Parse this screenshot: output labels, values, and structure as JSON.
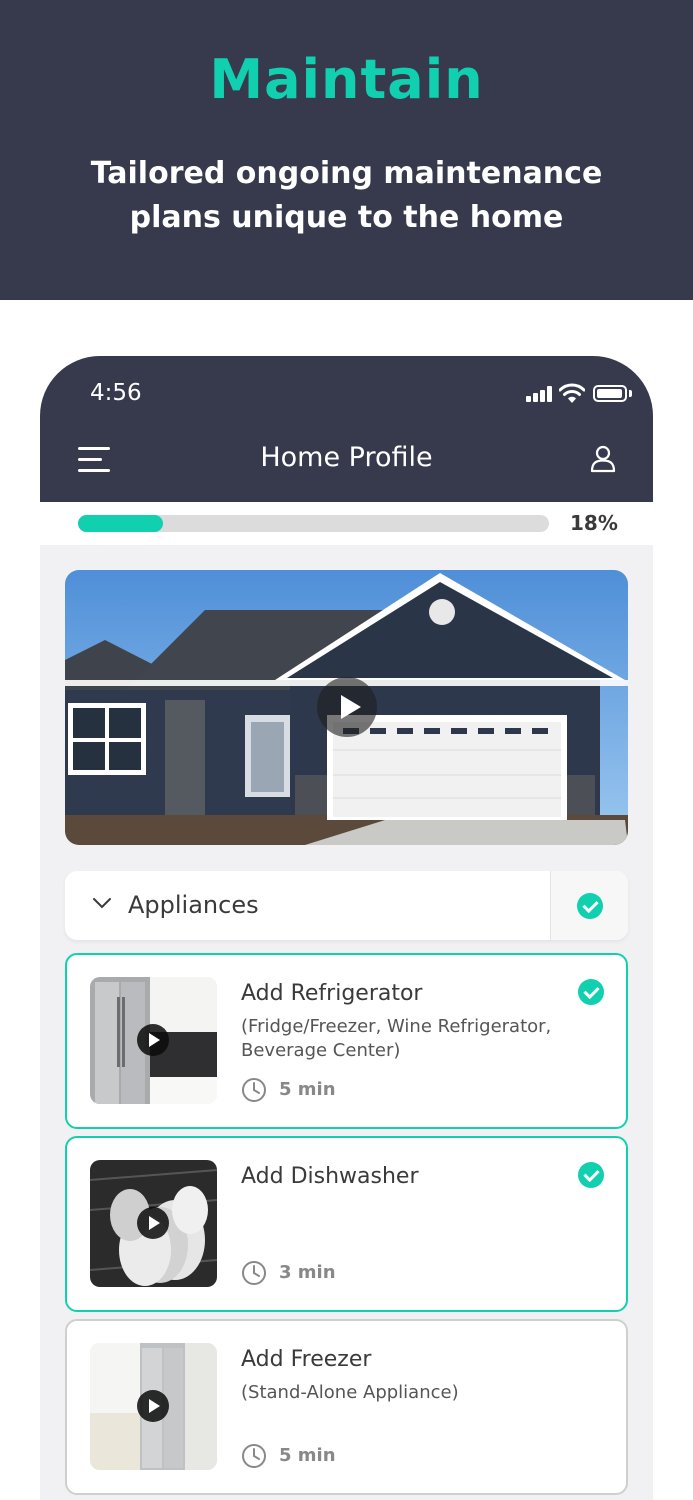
{
  "banner": {
    "title": "Maintain",
    "subtitle": "Tailored ongoing maintenance plans unique to the home"
  },
  "status_bar": {
    "time": "4:56"
  },
  "nav": {
    "title": "Home Profile",
    "menu_icon": "hamburger-menu-icon",
    "profile_icon": "user-icon"
  },
  "progress": {
    "label": "18%",
    "fraction": 0.18
  },
  "hero": {
    "icon": "play-icon"
  },
  "category": {
    "label": "Appliances",
    "completed": true
  },
  "items": [
    {
      "title": "Add Refrigerator",
      "subtitle": "(Fridge/Freezer, Wine Refrigerator, Beverage Center)",
      "time": "5 min",
      "completed": true
    },
    {
      "title": "Add Dishwasher",
      "subtitle": "",
      "time": "3 min",
      "completed": true
    },
    {
      "title": "Add Freezer",
      "subtitle": "(Stand-Alone Appliance)",
      "time": "5 min",
      "completed": false
    }
  ],
  "colors": {
    "accent": "#11d0b0",
    "header": "#373a4d",
    "background": "#f1f1f3"
  }
}
